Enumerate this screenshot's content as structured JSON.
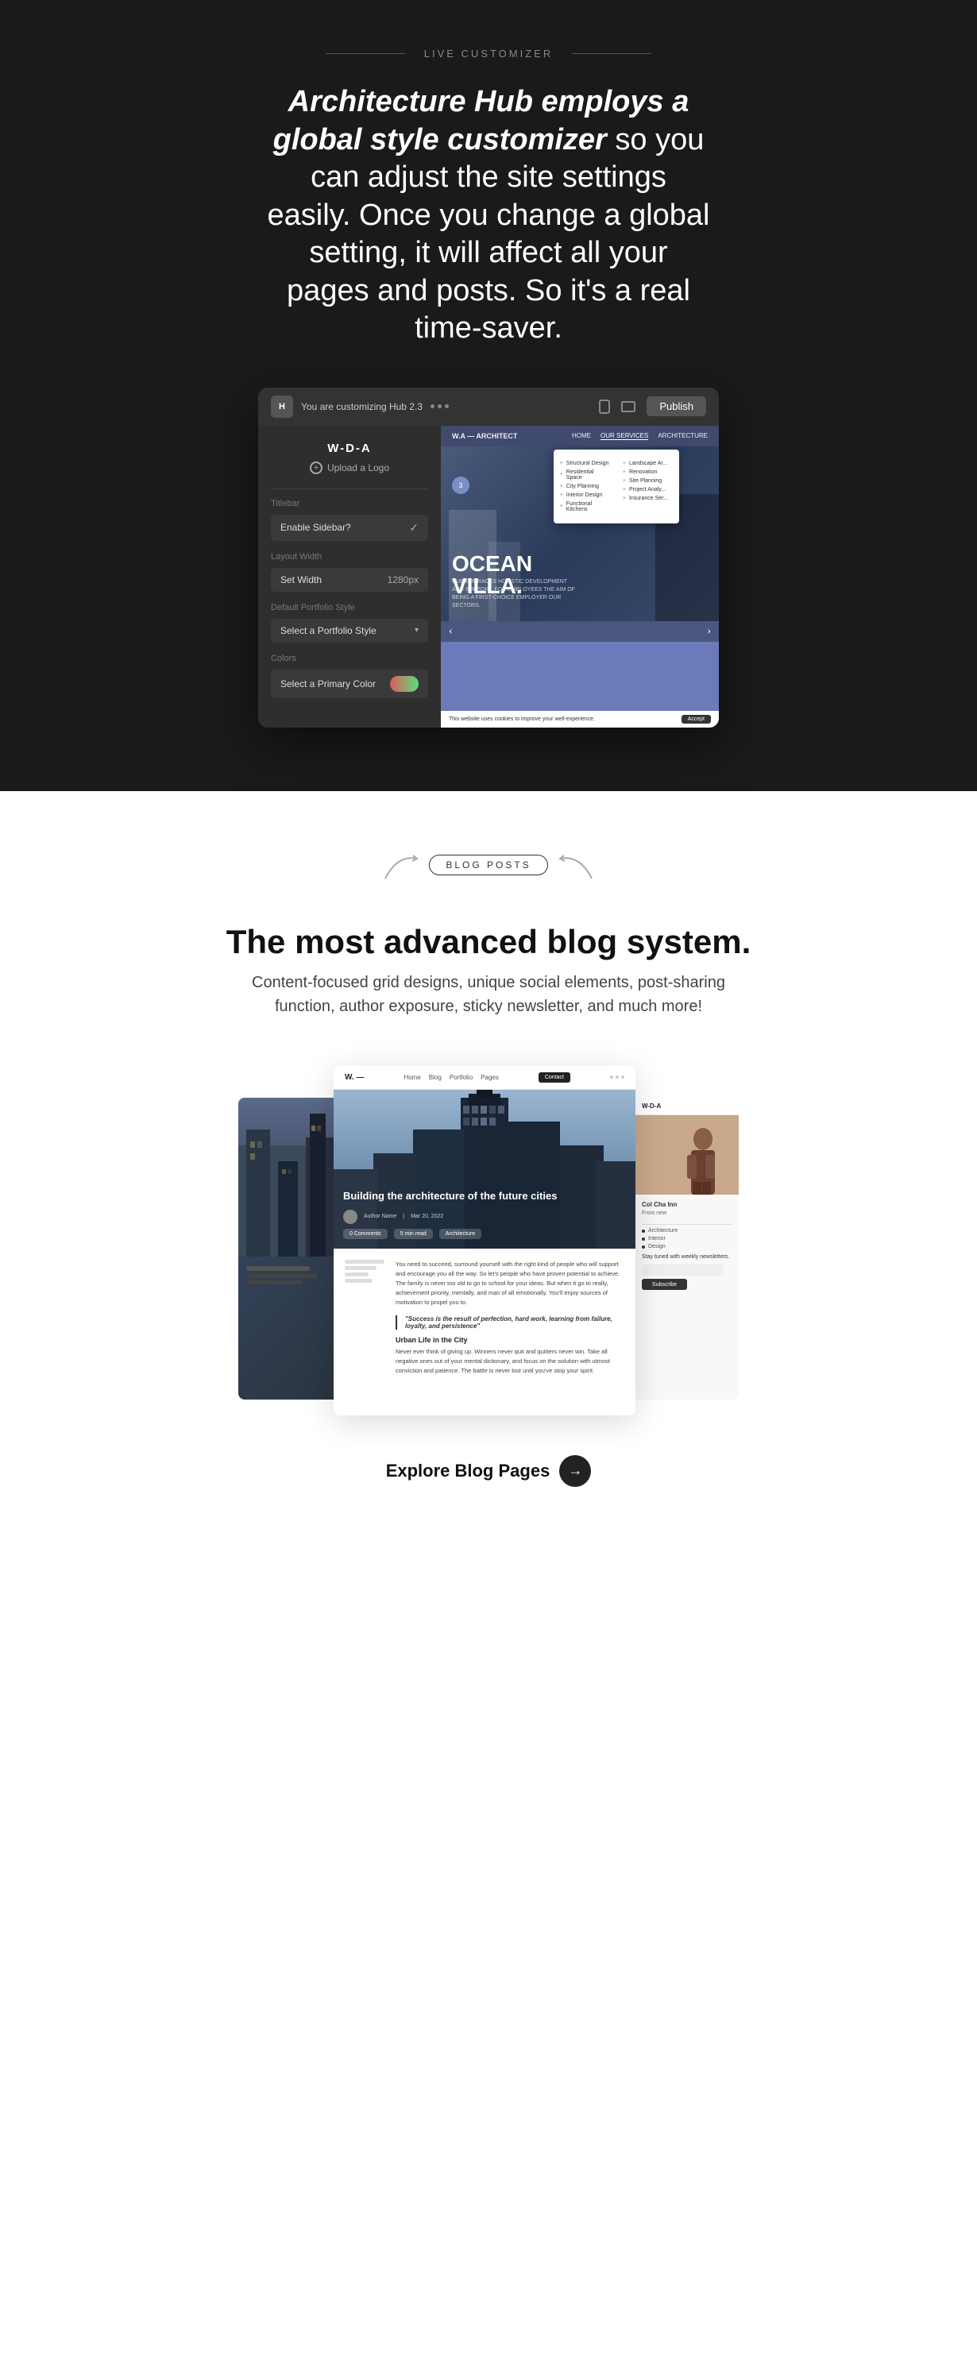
{
  "section1": {
    "label": "LIVE CUSTOMIZER",
    "headline_bold": "Architecture Hub employs a global style customizer",
    "headline_light": " so you can adjust the site settings easily. Once you change a global setting, it will affect all your pages and posts. So it's a real time-saver.",
    "topbar": {
      "customizing_text": "You are customizing Hub 2.3",
      "publish_label": "Publish"
    },
    "sidebar": {
      "logo_name": "W-D-A",
      "upload_logo_label": "Upload a Logo",
      "titlebar_label": "Titlebar",
      "enable_sidebar_label": "Enable Sidebar?",
      "layout_width_label": "Layout Width",
      "set_width_label": "Set Width",
      "set_width_value": "1280px",
      "default_portfolio_label": "Default Portfolio Style",
      "select_portfolio_label": "Select a Portfolio Style",
      "colors_label": "Colors",
      "select_primary_label": "Select a Primary Color"
    },
    "preview": {
      "nav_logo": "W.A — ARCHITECT",
      "nav_links": [
        "HOME",
        "OUR SERVICES",
        "ARCHITECTURE"
      ],
      "badge": "3",
      "headline_line1": "OCEAN",
      "headline_line2": "VILLA.",
      "sub_text": "HUB EMBRACES HOLISTIC DEVELOPMENT AND SUPPORT. FOR EMPLOYEES THE AIM OF BEING A FIRST-CHOICE EMPLOYER OUR SECTORS.",
      "cookie_text": "This website uses cookies to improve your well-experience.",
      "cookie_btn": "Accept",
      "menu_items_col1": [
        "Structural Design",
        "Residential Space",
        "City Planning",
        "Interior Design",
        "Functional Kitchens"
      ],
      "menu_items_col2": [
        "Landscape Ar...",
        "Renovation",
        "Site Planning",
        "Project Analy...",
        "Insurance Ser..."
      ]
    }
  },
  "section2": {
    "label": "BLOG POSTS",
    "headline": "The most advanced blog system.",
    "subtext": "Content-focused grid designs, unique social elements, post-sharing function, author exposure, sticky newsletter, and much more!",
    "center_blog": {
      "nav_logo": "W. —",
      "hero_title": "Building the architecture of the future cities",
      "content_intro": "You need to succeed, surround yourself with the right kind of people who will support and encourage you all the way. So let's people who have proven potential to achieve. The family is never too old to go to school for your ideas. But when it go to really, achievement priority, mentally, and man of all emotionally. You'll enjoy sources of motivation to propel you to.",
      "quote": "\"Success is the result of perfection, hard work, learning from failure, loyalty, and persistence\"",
      "subheading1": "Urban Life in the City",
      "content2": "Never ever think of giving up. Winners never quit and quitters never win. Take all negative ones out of your mental dictionary, and focus on the solution with utmost conviction and patience. The battle is never lost until you've stop your spirit."
    },
    "right_blog": {
      "title": "Col Cha Inn",
      "nav_logo": "W-D-A",
      "newsletter_text": "Stay tuned with weekly newsletters."
    },
    "explore_label": "Explore Blog Pages",
    "explore_arrow": "→"
  }
}
